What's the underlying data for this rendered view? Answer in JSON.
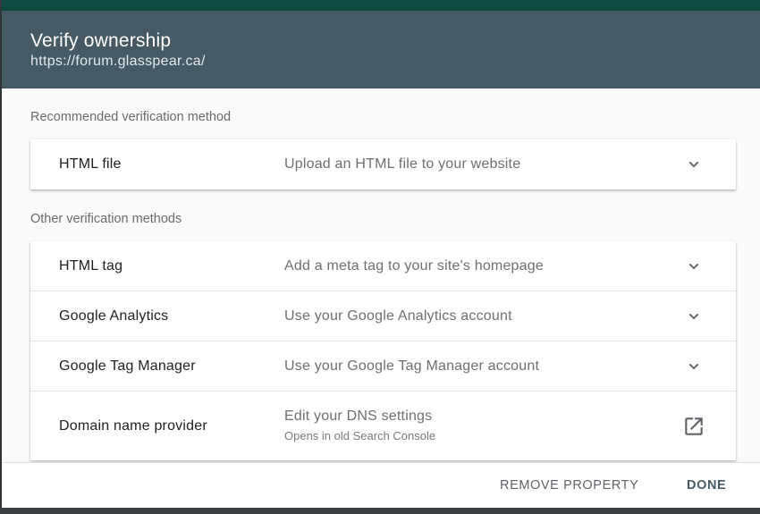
{
  "dialog": {
    "title": "Verify ownership",
    "url": "https://forum.glasspear.ca/"
  },
  "recommended": {
    "label": "Recommended verification method",
    "methods": [
      {
        "name": "HTML file",
        "description": "Upload an HTML file to your website",
        "icon": "chevron-down-icon"
      }
    ]
  },
  "other": {
    "label": "Other verification methods",
    "methods": [
      {
        "name": "HTML tag",
        "description": "Add a meta tag to your site's homepage",
        "icon": "chevron-down-icon"
      },
      {
        "name": "Google Analytics",
        "description": "Use your Google Analytics account",
        "icon": "chevron-down-icon"
      },
      {
        "name": "Google Tag Manager",
        "description": "Use your Google Tag Manager account",
        "icon": "chevron-down-icon"
      },
      {
        "name": "Domain name provider",
        "description": "Edit your DNS settings",
        "subtext": "Opens in old Search Console",
        "icon": "open-in-new-icon"
      }
    ]
  },
  "footer": {
    "remove_label": "REMOVE PROPERTY",
    "done_label": "DONE"
  },
  "colors": {
    "header_bg": "#455a64",
    "accent_bar": "#0d4a3f",
    "backdrop": "#3a3f42"
  }
}
